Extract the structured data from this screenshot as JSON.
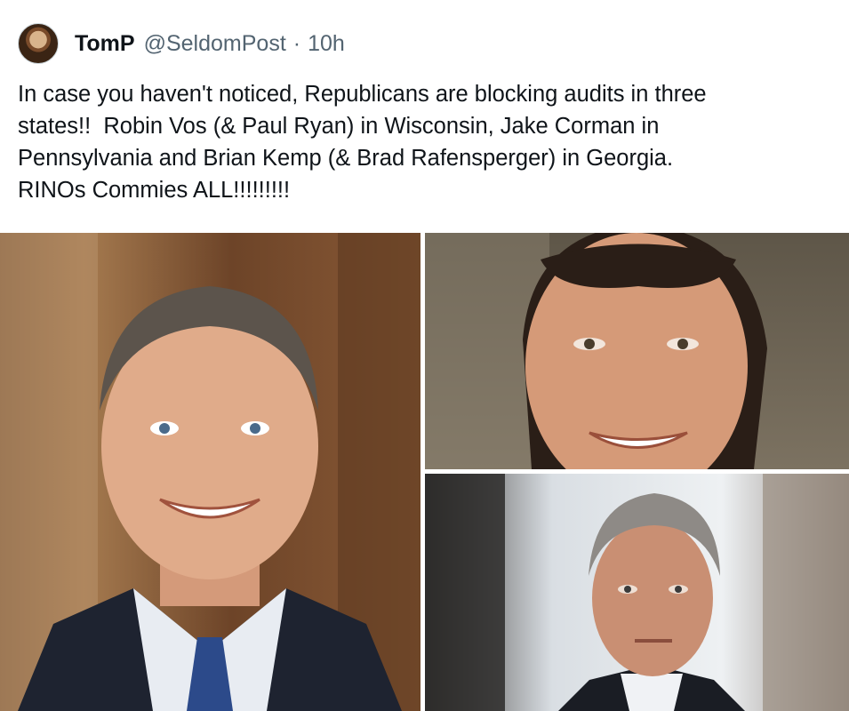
{
  "tweet": {
    "display_name": "TomP",
    "handle": "@SeldomPost",
    "separator": "·",
    "time": "10h",
    "text": "In case you haven't noticed, Republicans are blocking audits in three\nstates!!  Robin Vos (& Paul Ryan) in Wisconsin, Jake Corman in\nPennsylvania and Brian Kemp (& Brad Rafensperger) in Georgia.\nRINOs Commies ALL!!!!!!!!!"
  },
  "media": {
    "photos": [
      {
        "name": "photo-left"
      },
      {
        "name": "photo-top-right"
      },
      {
        "name": "photo-bottom-right"
      }
    ]
  },
  "icons": {
    "avatar": "avatar-portrait"
  }
}
